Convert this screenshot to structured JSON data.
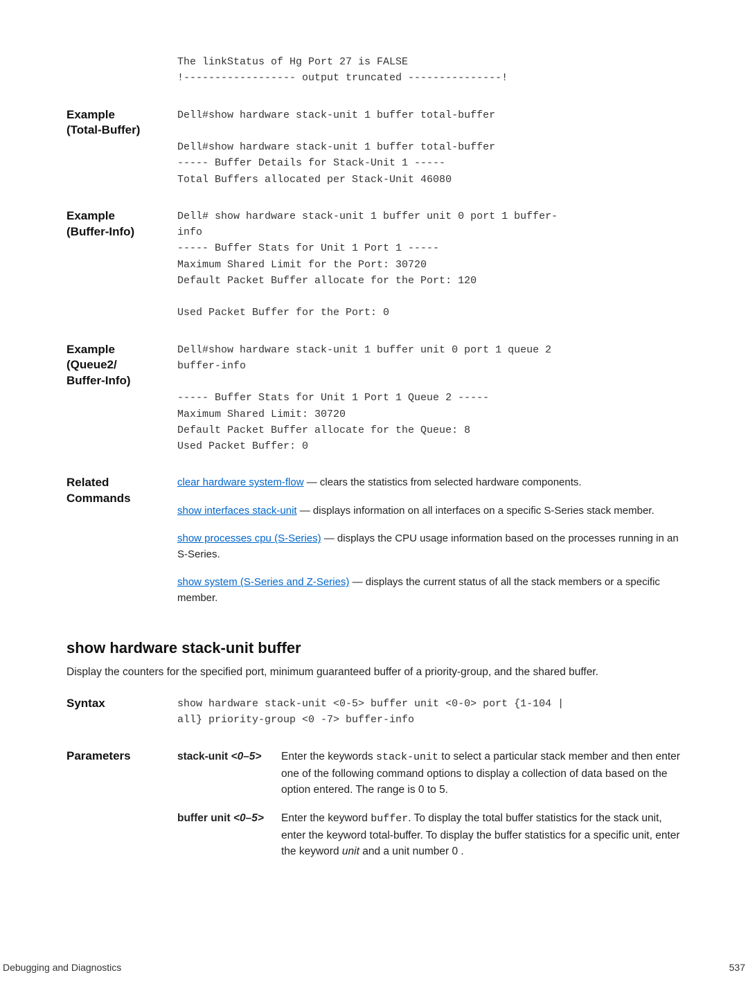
{
  "top_pre": "The linkStatus of Hg Port 27 is FALSE\n!------------------ output truncated ---------------!",
  "sections": [
    {
      "label": "Example\n(Total-Buffer)",
      "pre": "Dell#show hardware stack-unit 1 buffer total-buffer\n\nDell#show hardware stack-unit 1 buffer total-buffer\n----- Buffer Details for Stack-Unit 1 -----\nTotal Buffers allocated per Stack-Unit 46080"
    },
    {
      "label": "Example\n(Buffer-Info)",
      "pre": "Dell# show hardware stack-unit 1 buffer unit 0 port 1 buffer-\ninfo\n----- Buffer Stats for Unit 1 Port 1 -----\nMaximum Shared Limit for the Port: 30720\nDefault Packet Buffer allocate for the Port: 120\n\nUsed Packet Buffer for the Port: 0"
    },
    {
      "label": "Example\n(Queue2/\nBuffer-Info)",
      "pre": "Dell#show hardware stack-unit 1 buffer unit 0 port 1 queue 2\nbuffer-info\n\n----- Buffer Stats for Unit 1 Port 1 Queue 2 -----\nMaximum Shared Limit: 30720\nDefault Packet Buffer allocate for the Queue: 8\nUsed Packet Buffer: 0"
    }
  ],
  "related": {
    "label": "Related\nCommands",
    "items": [
      {
        "link": "clear hardware system-flow",
        "rest": " — clears the statistics from selected hardware components."
      },
      {
        "link": "show interfaces stack-unit",
        "rest": " — displays information on all interfaces on a specific S-Series stack member."
      },
      {
        "link": "show processes cpu (S-Series)",
        "rest": " — displays the CPU usage information based on the processes running in an S-Series."
      },
      {
        "link": "show system (S-Series and Z-Series)",
        "rest": " — displays the current status of all the stack members or a specific member."
      }
    ]
  },
  "cmd": {
    "title": "show hardware stack-unit buffer",
    "desc": "Display the counters for the specified port, minimum guaranteed buffer of a priority-group, and the shared buffer.",
    "syntax_label": "Syntax",
    "syntax_pre": "show hardware stack-unit <0-5> buffer unit <0-0> port {1-104 |\nall} priority-group <0 -7> buffer-info",
    "params_label": "Parameters",
    "params": [
      {
        "name_plain": "stack-unit ",
        "name_ital": "<0–5>",
        "desc_pre": "Enter the keywords ",
        "desc_kw": "stack-unit",
        "desc_post": " to select a particular stack member and then enter one of the following command options to display a collection of data based on the option entered. The range is 0 to 5."
      },
      {
        "name_plain": "buffer unit ",
        "name_ital": "<0–5>",
        "desc_pre": "Enter the keyword ",
        "desc_kw": "buffer",
        "desc_post": ". To display the total buffer statistics for the stack unit, enter the keyword total-buffer. To display the buffer statistics for a specific unit, enter the keyword ",
        "desc_ital": "unit",
        "desc_post2": " and a unit number 0 ."
      }
    ]
  },
  "footer": {
    "left": "Debugging and Diagnostics",
    "right": "537"
  }
}
